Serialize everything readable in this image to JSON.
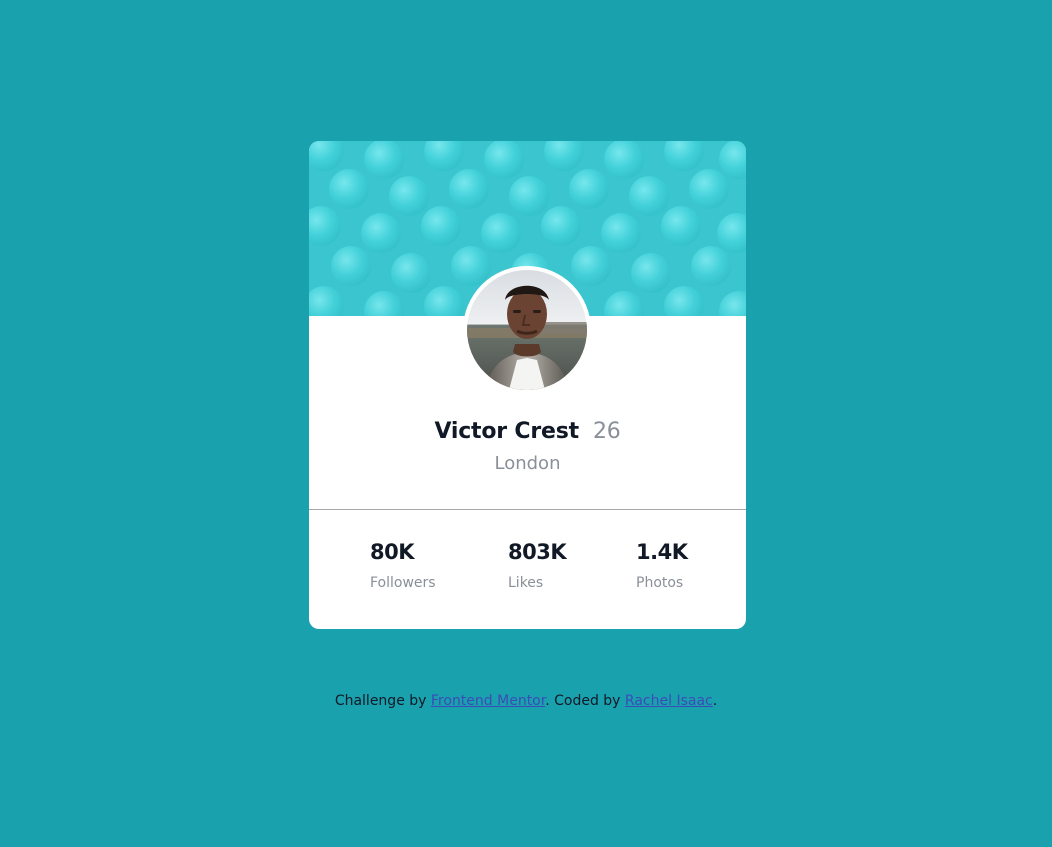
{
  "profile": {
    "name": "Victor Crest",
    "age": "26",
    "location": "London"
  },
  "stats": [
    {
      "value": "80K",
      "label": "Followers"
    },
    {
      "value": "803K",
      "label": "Likes"
    },
    {
      "value": "1.4K",
      "label": "Photos"
    }
  ],
  "footer": {
    "prefix": "Challenge by ",
    "challenge_link": "Frontend Mentor",
    "middle": ". Coded by ",
    "author_link": "Rachel Isaac",
    "suffix": "."
  },
  "colors": {
    "page_background": "#19a1ae",
    "banner_background": "#3bc5cf",
    "card_background": "#ffffff",
    "primary_text": "#111826",
    "muted_text": "#8a8f98",
    "link": "#3b4cb8"
  },
  "icons": {
    "avatar": "profile-photo",
    "banner_pattern": "circle-pattern"
  }
}
